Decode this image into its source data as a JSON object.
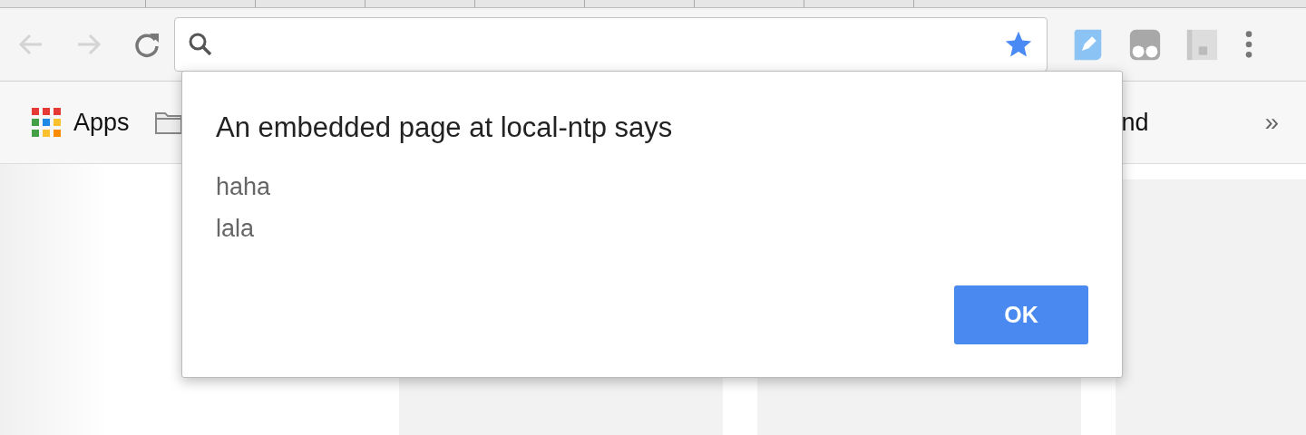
{
  "toolbar": {
    "nav": [
      {
        "kind": "back",
        "disabled": true
      },
      {
        "kind": "forward",
        "disabled": true
      },
      {
        "kind": "reload",
        "disabled": false
      }
    ],
    "bookmarked": true,
    "extensions": [
      {
        "kind": "pen"
      },
      {
        "kind": "glasses"
      },
      {
        "kind": "rp"
      }
    ]
  },
  "bookmarks": {
    "items": [
      {
        "kind": "apps",
        "label": "Apps"
      },
      {
        "kind": "folder"
      },
      {
        "kind": "link",
        "label": "nd"
      }
    ],
    "more": "»"
  },
  "dialog": {
    "title": "An embedded page at local-ntp says",
    "lines": [
      "haha",
      "lala"
    ],
    "button": "OK"
  }
}
